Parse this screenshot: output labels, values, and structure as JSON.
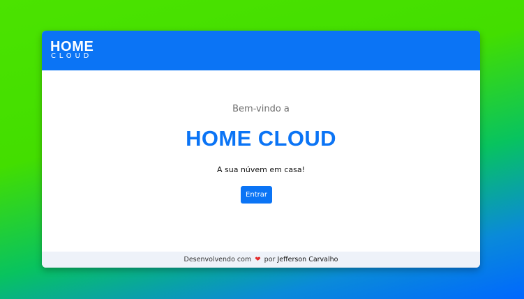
{
  "header": {
    "logo_top": "HOME",
    "logo_bottom": "CLOUD"
  },
  "main": {
    "welcome": "Bem-vindo a",
    "title": "HOME CLOUD",
    "tagline": "A sua núvem em casa!",
    "enter_label": "Entrar"
  },
  "footer": {
    "prefix": "Desenvolvendo com",
    "heart": "❤",
    "connector": "por",
    "author": "Jefferson Carvalho"
  },
  "colors": {
    "brand": "#0b74f5",
    "heart": "#e42d2d",
    "footer_bg": "#eef2f9"
  }
}
